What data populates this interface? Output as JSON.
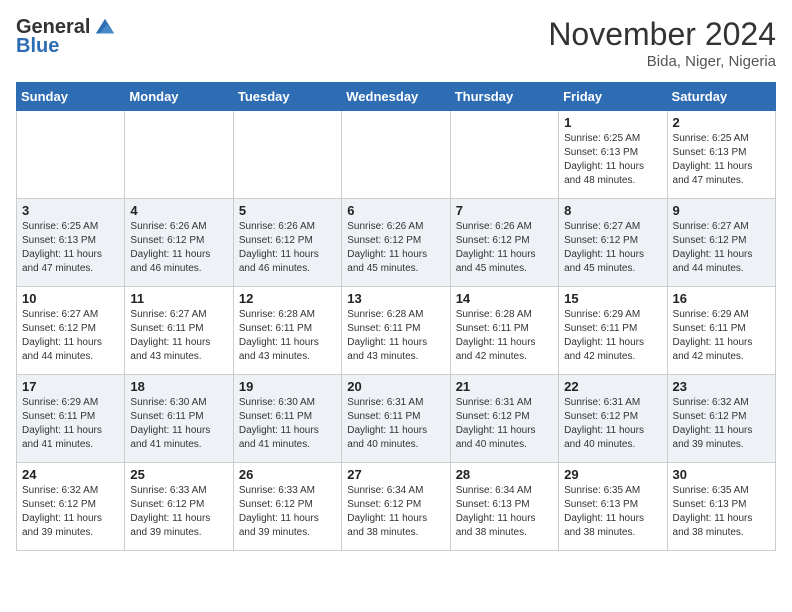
{
  "header": {
    "logo_general": "General",
    "logo_blue": "Blue",
    "month_title": "November 2024",
    "location": "Bida, Niger, Nigeria"
  },
  "weekdays": [
    "Sunday",
    "Monday",
    "Tuesday",
    "Wednesday",
    "Thursday",
    "Friday",
    "Saturday"
  ],
  "weeks": [
    [
      {
        "day": "",
        "info": ""
      },
      {
        "day": "",
        "info": ""
      },
      {
        "day": "",
        "info": ""
      },
      {
        "day": "",
        "info": ""
      },
      {
        "day": "",
        "info": ""
      },
      {
        "day": "1",
        "info": "Sunrise: 6:25 AM\nSunset: 6:13 PM\nDaylight: 11 hours\nand 48 minutes."
      },
      {
        "day": "2",
        "info": "Sunrise: 6:25 AM\nSunset: 6:13 PM\nDaylight: 11 hours\nand 47 minutes."
      }
    ],
    [
      {
        "day": "3",
        "info": "Sunrise: 6:25 AM\nSunset: 6:13 PM\nDaylight: 11 hours\nand 47 minutes."
      },
      {
        "day": "4",
        "info": "Sunrise: 6:26 AM\nSunset: 6:12 PM\nDaylight: 11 hours\nand 46 minutes."
      },
      {
        "day": "5",
        "info": "Sunrise: 6:26 AM\nSunset: 6:12 PM\nDaylight: 11 hours\nand 46 minutes."
      },
      {
        "day": "6",
        "info": "Sunrise: 6:26 AM\nSunset: 6:12 PM\nDaylight: 11 hours\nand 45 minutes."
      },
      {
        "day": "7",
        "info": "Sunrise: 6:26 AM\nSunset: 6:12 PM\nDaylight: 11 hours\nand 45 minutes."
      },
      {
        "day": "8",
        "info": "Sunrise: 6:27 AM\nSunset: 6:12 PM\nDaylight: 11 hours\nand 45 minutes."
      },
      {
        "day": "9",
        "info": "Sunrise: 6:27 AM\nSunset: 6:12 PM\nDaylight: 11 hours\nand 44 minutes."
      }
    ],
    [
      {
        "day": "10",
        "info": "Sunrise: 6:27 AM\nSunset: 6:12 PM\nDaylight: 11 hours\nand 44 minutes."
      },
      {
        "day": "11",
        "info": "Sunrise: 6:27 AM\nSunset: 6:11 PM\nDaylight: 11 hours\nand 43 minutes."
      },
      {
        "day": "12",
        "info": "Sunrise: 6:28 AM\nSunset: 6:11 PM\nDaylight: 11 hours\nand 43 minutes."
      },
      {
        "day": "13",
        "info": "Sunrise: 6:28 AM\nSunset: 6:11 PM\nDaylight: 11 hours\nand 43 minutes."
      },
      {
        "day": "14",
        "info": "Sunrise: 6:28 AM\nSunset: 6:11 PM\nDaylight: 11 hours\nand 42 minutes."
      },
      {
        "day": "15",
        "info": "Sunrise: 6:29 AM\nSunset: 6:11 PM\nDaylight: 11 hours\nand 42 minutes."
      },
      {
        "day": "16",
        "info": "Sunrise: 6:29 AM\nSunset: 6:11 PM\nDaylight: 11 hours\nand 42 minutes."
      }
    ],
    [
      {
        "day": "17",
        "info": "Sunrise: 6:29 AM\nSunset: 6:11 PM\nDaylight: 11 hours\nand 41 minutes."
      },
      {
        "day": "18",
        "info": "Sunrise: 6:30 AM\nSunset: 6:11 PM\nDaylight: 11 hours\nand 41 minutes."
      },
      {
        "day": "19",
        "info": "Sunrise: 6:30 AM\nSunset: 6:11 PM\nDaylight: 11 hours\nand 41 minutes."
      },
      {
        "day": "20",
        "info": "Sunrise: 6:31 AM\nSunset: 6:11 PM\nDaylight: 11 hours\nand 40 minutes."
      },
      {
        "day": "21",
        "info": "Sunrise: 6:31 AM\nSunset: 6:12 PM\nDaylight: 11 hours\nand 40 minutes."
      },
      {
        "day": "22",
        "info": "Sunrise: 6:31 AM\nSunset: 6:12 PM\nDaylight: 11 hours\nand 40 minutes."
      },
      {
        "day": "23",
        "info": "Sunrise: 6:32 AM\nSunset: 6:12 PM\nDaylight: 11 hours\nand 39 minutes."
      }
    ],
    [
      {
        "day": "24",
        "info": "Sunrise: 6:32 AM\nSunset: 6:12 PM\nDaylight: 11 hours\nand 39 minutes."
      },
      {
        "day": "25",
        "info": "Sunrise: 6:33 AM\nSunset: 6:12 PM\nDaylight: 11 hours\nand 39 minutes."
      },
      {
        "day": "26",
        "info": "Sunrise: 6:33 AM\nSunset: 6:12 PM\nDaylight: 11 hours\nand 39 minutes."
      },
      {
        "day": "27",
        "info": "Sunrise: 6:34 AM\nSunset: 6:12 PM\nDaylight: 11 hours\nand 38 minutes."
      },
      {
        "day": "28",
        "info": "Sunrise: 6:34 AM\nSunset: 6:13 PM\nDaylight: 11 hours\nand 38 minutes."
      },
      {
        "day": "29",
        "info": "Sunrise: 6:35 AM\nSunset: 6:13 PM\nDaylight: 11 hours\nand 38 minutes."
      },
      {
        "day": "30",
        "info": "Sunrise: 6:35 AM\nSunset: 6:13 PM\nDaylight: 11 hours\nand 38 minutes."
      }
    ]
  ]
}
